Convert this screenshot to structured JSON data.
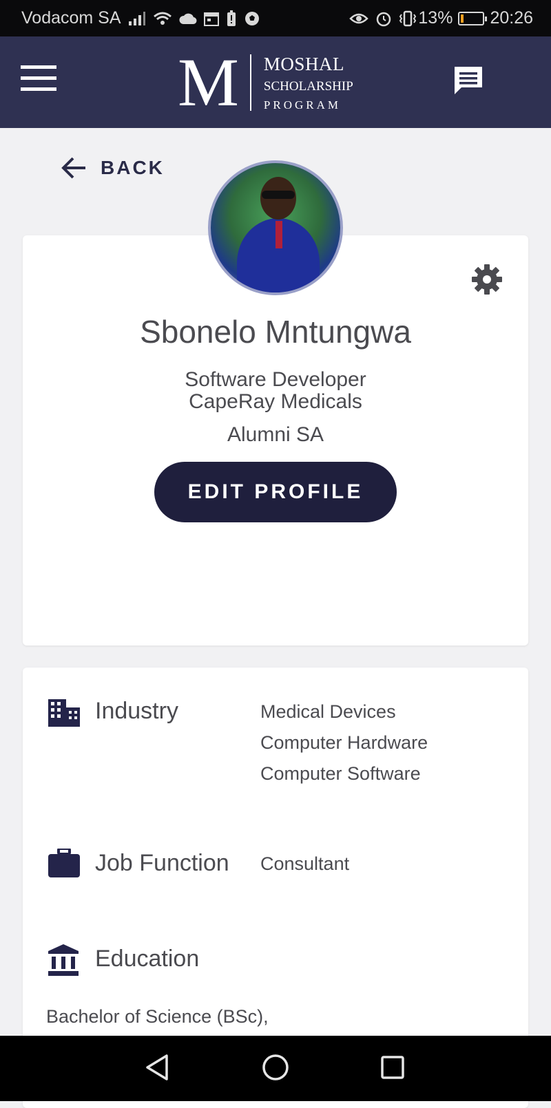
{
  "status_bar": {
    "carrier": "Vodacom SA",
    "battery_percent": "13%",
    "battery_level": 0.13,
    "time": "20:26",
    "icons": [
      "signal-icon",
      "wifi-icon",
      "cloud-icon",
      "calendar-icon",
      "battery-saver-icon",
      "soccer-icon",
      "eye-icon",
      "alarm-icon",
      "vibrate-icon",
      "battery-icon"
    ]
  },
  "header": {
    "logo_letter": "M",
    "logo_line1": "MOSHAL",
    "logo_line2": "SCHOLARSHIP",
    "logo_line3": "PROGRAM",
    "menu_icon": "hamburger-menu-icon",
    "chat_icon": "chat-icon"
  },
  "back": {
    "label": "BACK"
  },
  "profile": {
    "name": "Sbonelo Mntungwa",
    "job_title": "Software Developer",
    "company": "CapeRay Medicals",
    "group": "Alumni SA",
    "edit_label": "EDIT PROFILE",
    "settings_icon": "gear-icon"
  },
  "details": {
    "industry": {
      "label": "Industry",
      "values": [
        "Medical Devices",
        "Computer Hardware",
        "Computer Software"
      ]
    },
    "job_function": {
      "label": "Job Function",
      "value": "Consultant"
    },
    "education": {
      "label": "Education",
      "value": "Bachelor of Science (BSc),"
    }
  },
  "colors": {
    "header_bg": "#2f3152",
    "button_bg": "#1f1f3d",
    "page_bg": "#f1f1f3",
    "battery_fill": "#f0a020"
  }
}
